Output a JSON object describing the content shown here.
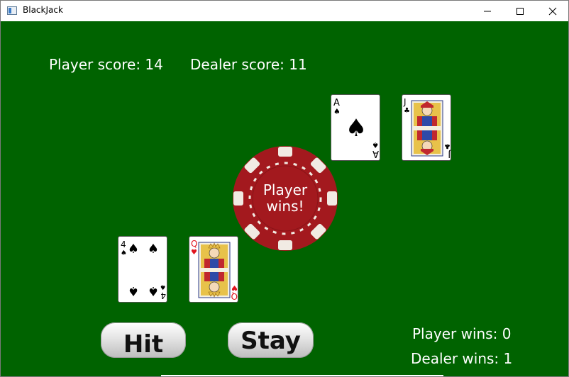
{
  "window": {
    "title": "BlackJack",
    "icon": "window-app-icon",
    "controls": [
      "minimize-icon",
      "maximize-icon",
      "close-icon"
    ]
  },
  "table": {
    "felt_color": "#006300",
    "player_score_label": "Player score: 14",
    "dealer_score_label": "Dealer score: 11"
  },
  "dealer_hand": [
    {
      "rank": "A",
      "suit": "spades",
      "suit_glyph": "♠",
      "color": "#000000"
    },
    {
      "rank": "J",
      "suit": "clubs",
      "suit_glyph": "♣",
      "color": "#000000"
    }
  ],
  "player_hand": [
    {
      "rank": "4",
      "suit": "spades",
      "suit_glyph": "♠",
      "color": "#000000"
    },
    {
      "rank": "Q",
      "suit": "hearts",
      "suit_glyph": "♥",
      "color": "#e0141e"
    }
  ],
  "result": {
    "text": "Player wins!",
    "chip_color": "#a3191e"
  },
  "buttons": {
    "hit_label": "Hit",
    "stay_label": "Stay"
  },
  "tally": {
    "player_wins": "Player wins: 0",
    "dealer_wins": "Dealer wins: 1"
  }
}
